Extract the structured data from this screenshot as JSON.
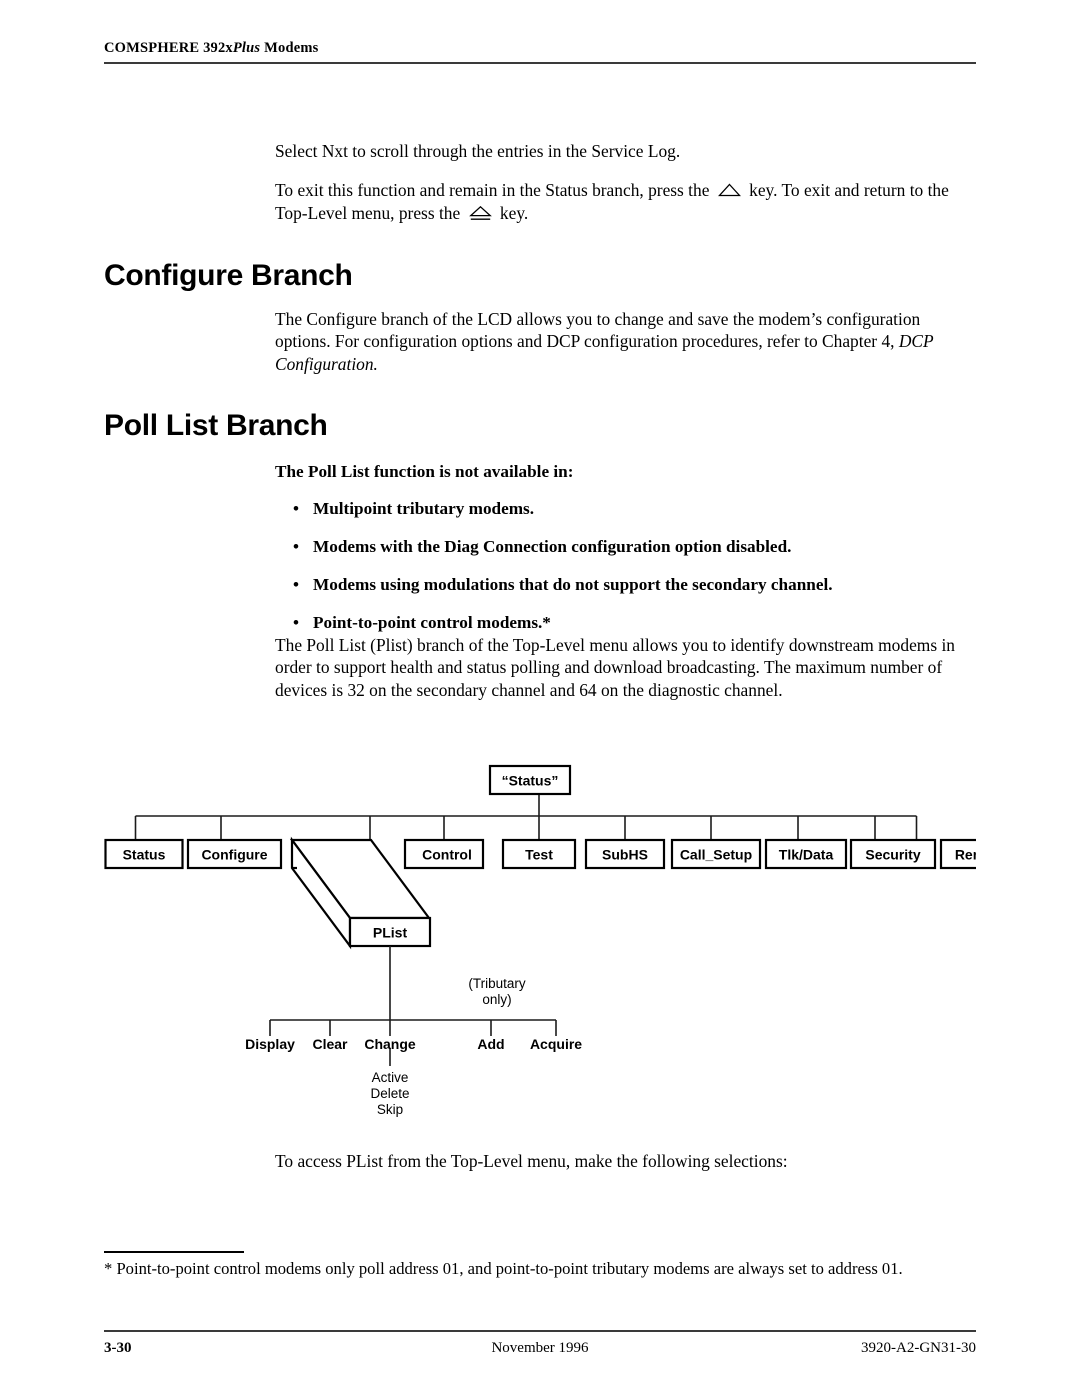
{
  "running_head": {
    "prefix": "COMSPHERE 392x",
    "italic": "Plus",
    "suffix": " Modems"
  },
  "intro": {
    "para1": "Select Nxt to scroll through the entries in the Service Log.",
    "para2_a": "To exit this function and remain in the Status branch, press the",
    "para2_b": "key. To exit and return to the",
    "para2_c": "Top-Level menu, press the",
    "para2_d": "key.",
    "key_icon_1": "triangle-key-icon",
    "key_icon_2": "triangle-underline-key-icon"
  },
  "configure_branch": {
    "heading": "Configure Branch",
    "para_a": "The Configure branch of the LCD allows you to change and save the modem’s configuration options. For configuration options and DCP configuration procedures, refer to Chapter 4,",
    "para_italic": "DCP Configuration."
  },
  "poll_list_branch": {
    "heading": "Poll List Branch",
    "note_lead": "The Poll List function is not available in:",
    "bullet_marker": "•",
    "bullets": [
      "Multipoint tributary modems.",
      "Modems with the Diag Connection configuration option disabled.",
      "Modems using modulations that do not support the secondary channel.",
      "Point-to-point control modems.*"
    ],
    "para": "The Poll List (Plist) branch of the Top-Level menu allows you to identify downstream modems in order to support health and status polling and download broadcasting. The maximum number of devices is 32 on the secondary channel and 64 on the diagnostic channel.",
    "closing": "To access PList from the Top-Level menu, make the following selections:"
  },
  "diagram": {
    "root": "“Status”",
    "level1": [
      "Status",
      "Configure",
      "PList",
      "Control",
      "Test",
      "SubHS",
      "Call_Setup",
      "Tlk/Data",
      "Security",
      "Remote"
    ],
    "highlighted_node": "PList",
    "level2": [
      "Display",
      "Clear",
      "Change",
      "Add",
      "Acquire"
    ],
    "level2_annotation_line1": "(Tributary",
    "level2_annotation_line2": "only)",
    "level3_under_change": [
      "Active",
      "Delete",
      "Skip"
    ],
    "line_color": "#1b1b1b"
  },
  "footnote": "* Point-to-point control modems only poll address 01, and point-to-point tributary modems are always set to address 01.",
  "footer": {
    "page": "3-30",
    "date": "November 1996",
    "doc_number": "3920-A2-GN31-30"
  }
}
